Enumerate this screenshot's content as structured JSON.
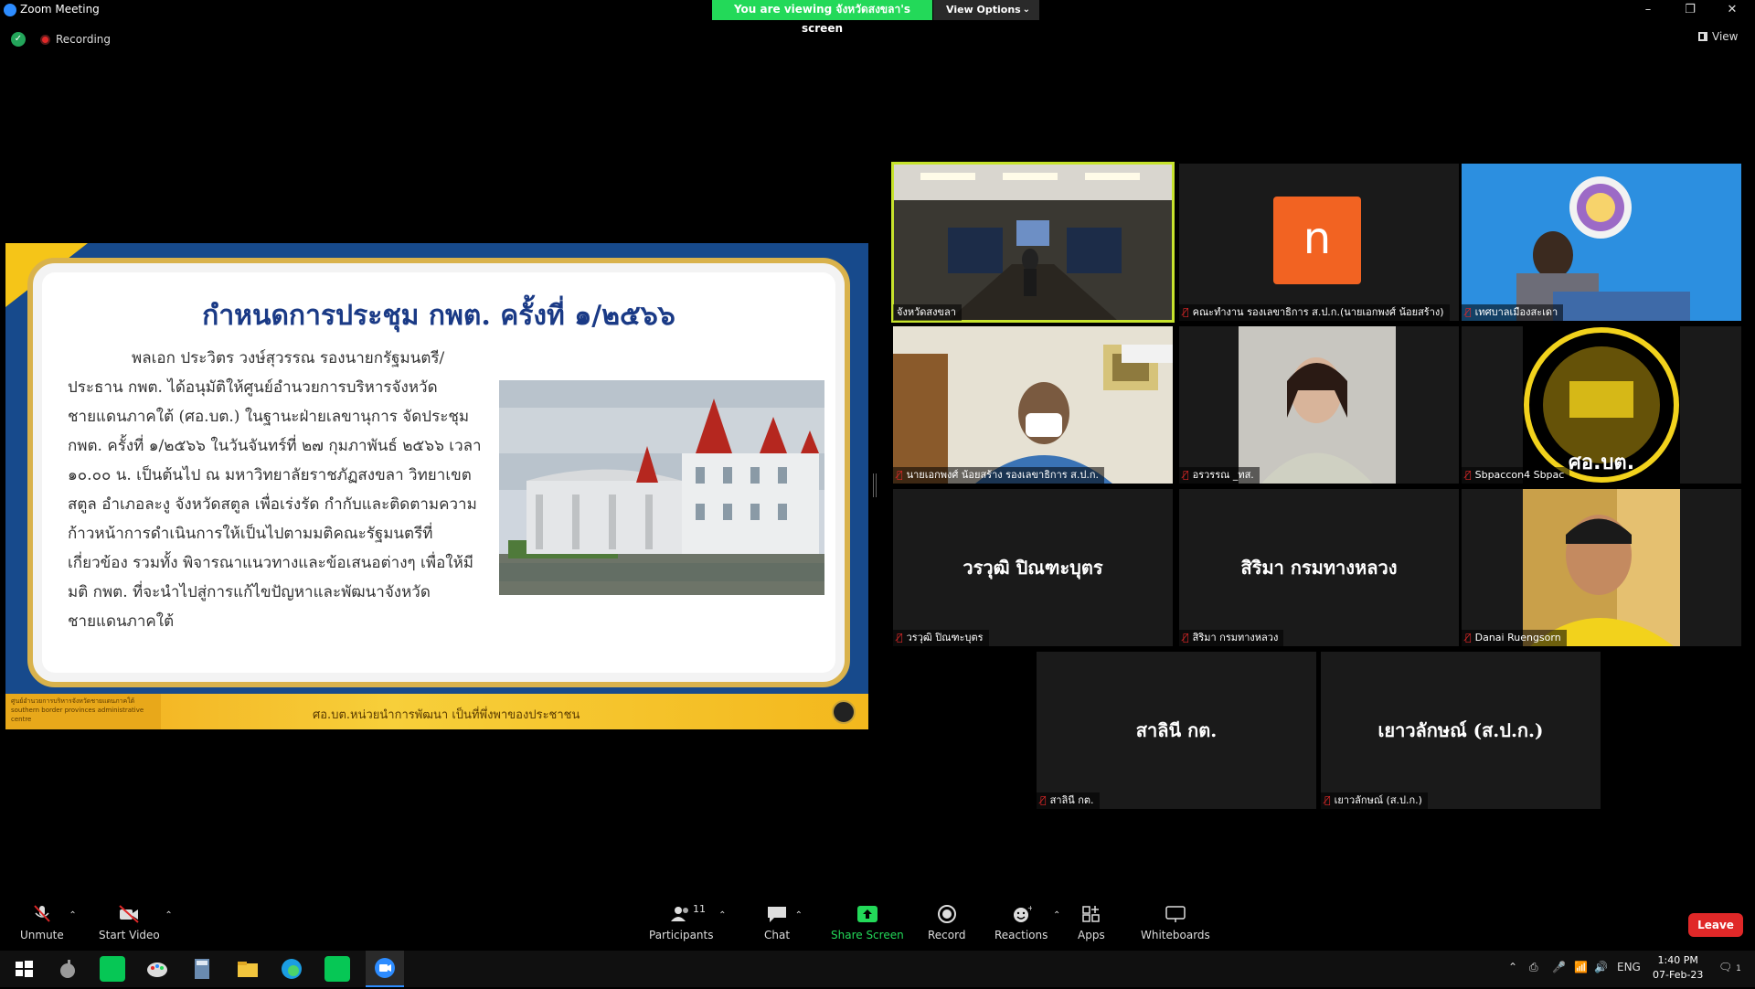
{
  "window": {
    "title": "Zoom Meeting",
    "viewing_banner": "You are viewing จังหวัดสงขลา's screen",
    "view_options": "View Options",
    "minimize": "–",
    "restore": "❐",
    "close": "✕"
  },
  "status": {
    "recording": "Recording",
    "view": "View"
  },
  "slide": {
    "title": "กำหนดการประชุม กพต. ครั้งที่ ๑/๒๕๖๖",
    "body": "พลเอก ประวิตร วงษ์สุวรรณ รองนายกรัฐมนตรี/ประธาน กพต. ได้อนุมัติให้ศูนย์อำนวยการบริหารจังหวัดชายแดนภาคใต้ (ศอ.บต.) ในฐานะฝ่ายเลขานุการ จัดประชุม กพต. ครั้งที่ ๑/๒๕๖๖ ในวันจันทร์ที่ ๒๗ กุมภาพันธ์ ๒๕๖๖ เวลา ๑๐.๐๐ น. เป็นต้นไป ณ มหาวิทยาลัยราชภัฏสงขลา วิทยาเขตสตูล อำเภอละงู จังหวัดสตูล เพื่อเร่งรัด กำกับและติดตามความก้าวหน้าการดำเนินการให้เป็นไปตามมติคณะรัฐมนตรีที่เกี่ยวข้อง รวมทั้ง พิจารณาแนวทางและข้อเสนอต่างๆ เพื่อให้มีมติ กพต. ที่จะนำไปสู่การแก้ไขปัญหาและพัฒนาจังหวัดชายแดนภาคใต้",
    "footer_org": "ศูนย์อำนวยการบริหารจังหวัดชายแดนภาคใต้ southern border provinces administrative centre",
    "footer_slogan": "ศอ.บต.หน่วยนำการพัฒนา เป็นที่พึ่งพาของประชาชน"
  },
  "participants": [
    {
      "label": "จังหวัดสงขลา",
      "type": "video",
      "active": true,
      "muted": false
    },
    {
      "label": "คณะทำงาน รองเลขาธิการ ส.ป.ก.(นายเอกพงศ์ น้อยสร้าง)",
      "type": "avatar",
      "initial": "n",
      "muted": true
    },
    {
      "label": "เทศบาลเมืองสะเดา",
      "type": "video",
      "muted": true
    },
    {
      "label": "นายเอกพงศ์ น้อยสร้าง รองเลขาธิการ ส.ป.ก.",
      "type": "video",
      "muted": true
    },
    {
      "label": "อรวรรณ _ทส.",
      "type": "video",
      "muted": true
    },
    {
      "label": "Sbpaccon4 Sbpac",
      "type": "video",
      "muted": true
    },
    {
      "label": "วรวุฒิ ปิณฑะบุตร",
      "type": "name",
      "muted": true
    },
    {
      "label": "สิริมา กรมทางหลวง",
      "type": "name",
      "muted": true
    },
    {
      "label": "Danai Ruengsorn",
      "type": "video",
      "muted": true
    },
    {
      "label": "สาลินี กต.",
      "type": "name",
      "muted": true
    },
    {
      "label": "เยาวลักษณ์ (ส.ป.ก.)",
      "type": "name",
      "muted": true
    }
  ],
  "toolbar": {
    "unmute": "Unmute",
    "start_video": "Start Video",
    "participants": "Participants",
    "participant_count": "11",
    "chat": "Chat",
    "share_screen": "Share Screen",
    "record": "Record",
    "reactions": "Reactions",
    "apps": "Apps",
    "whiteboards": "Whiteboards",
    "leave": "Leave"
  },
  "taskbar": {
    "language": "ENG",
    "time": "1:40 PM",
    "date": "07-Feb-23",
    "notification_count": "1"
  },
  "colors": {
    "accent": "#2d8cff",
    "banner_green": "#23d959",
    "leave_red": "#e02828",
    "active_speaker": "#c6e22c",
    "avatar_orange": "#f26322"
  }
}
